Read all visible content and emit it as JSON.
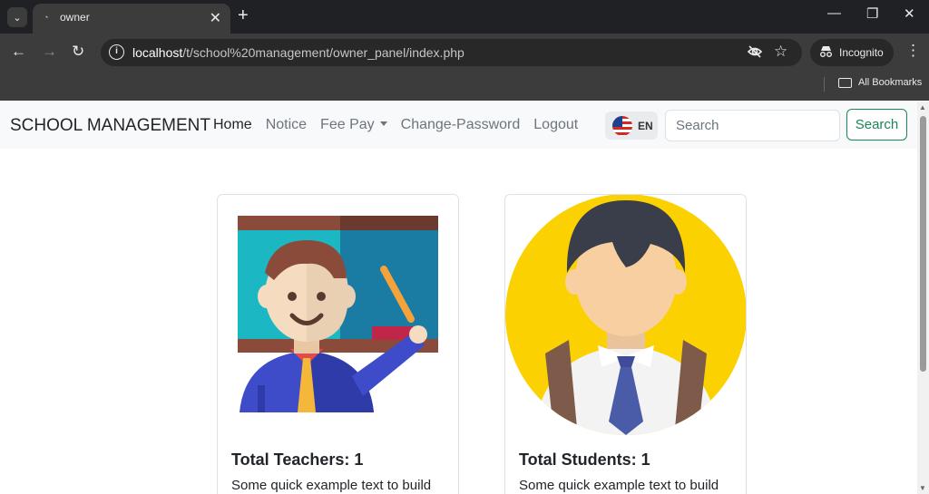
{
  "browser": {
    "tab_title": "owner",
    "url_host": "localhost",
    "url_path": "/t/school%20management/owner_panel/index.php",
    "incognito_label": "Incognito",
    "bookmarks_label": "All Bookmarks"
  },
  "navbar": {
    "brand": "SCHOOL MANAGEMENT",
    "links": [
      "Home",
      "Notice",
      "Fee Pay",
      "Change-Password",
      "Logout"
    ],
    "language": "EN",
    "search_placeholder": "Search",
    "search_button": "Search"
  },
  "cards": [
    {
      "title": "Total Teachers: 1",
      "text": "Some quick example text to build"
    },
    {
      "title": "Total Students: 1",
      "text": "Some quick example text to build"
    }
  ],
  "icons": [
    "tab-search-icon",
    "close-icon",
    "plus-icon",
    "minimize-icon",
    "restore-icon",
    "back-icon",
    "forward-icon",
    "reload-icon",
    "info-icon",
    "eye-slash-icon",
    "star-icon",
    "incognito-icon",
    "more-icon",
    "folder-icon",
    "us-flag-icon"
  ],
  "colors": {
    "search_button": "#198754",
    "navbar_bg": "#f8f9fa"
  }
}
